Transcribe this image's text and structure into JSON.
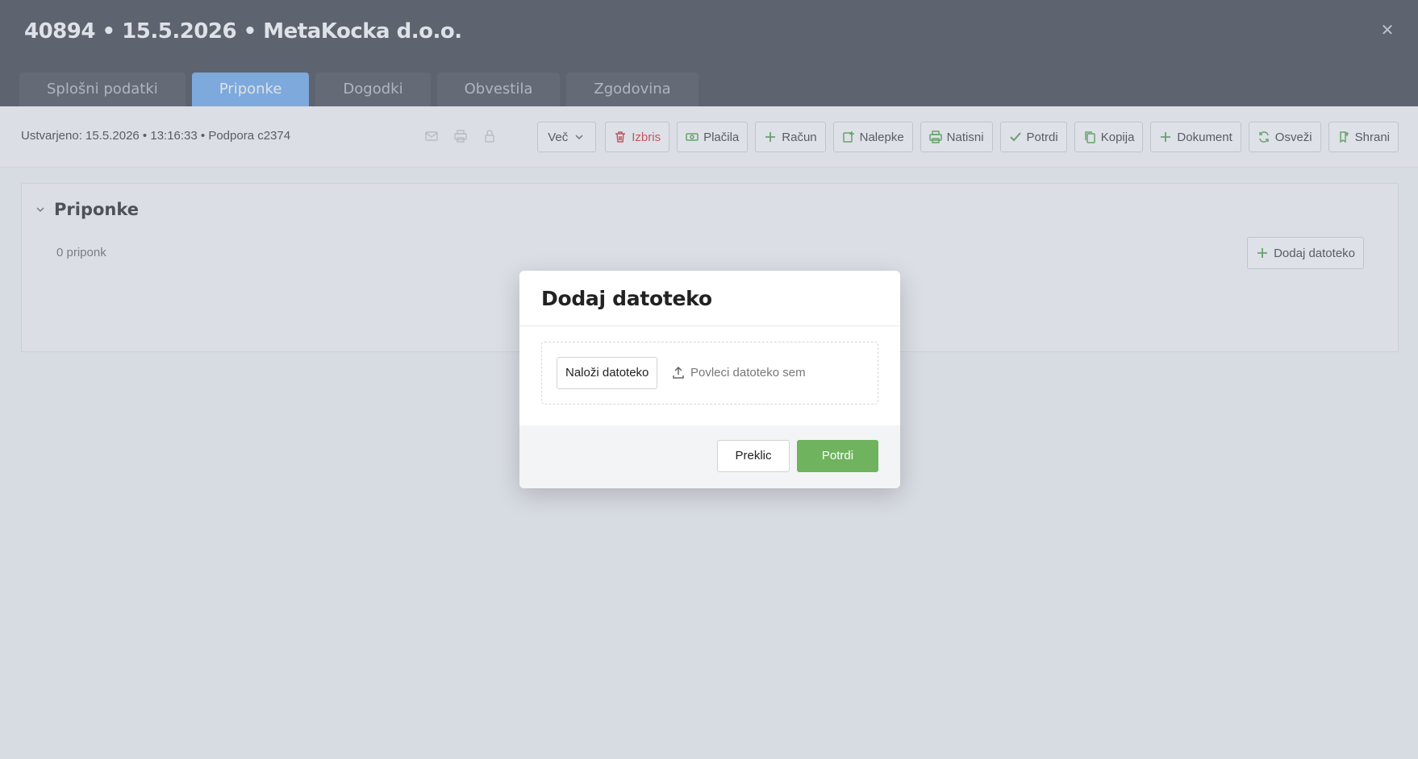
{
  "header": {
    "title": "40894 • 15.5.2026 • MetaKocka d.o.o.",
    "close_icon": "close-icon"
  },
  "tabs": [
    {
      "label": "Splošni podatki",
      "active": false
    },
    {
      "label": "Priponke",
      "active": true
    },
    {
      "label": "Dogodki",
      "active": false
    },
    {
      "label": "Obvestila",
      "active": false
    },
    {
      "label": "Zgodovina",
      "active": false
    }
  ],
  "toolbar": {
    "created_text": "Ustvarjeno: 15.5.2026 • 13:16:33 • Podpora c2374",
    "buttons": [
      {
        "label": "Več",
        "icon": "chevron-down-icon"
      },
      {
        "label": "Izbris",
        "icon": "trash-icon",
        "color": "#cf2b2b"
      },
      {
        "label": "Plačila",
        "icon": "money-icon"
      },
      {
        "label": "Račun",
        "icon": "plus-icon"
      },
      {
        "label": "Nalepke",
        "icon": "label-icon"
      },
      {
        "label": "Natisni",
        "icon": "printer-icon"
      },
      {
        "label": "Potrdi",
        "icon": "check-icon"
      },
      {
        "label": "Kopija",
        "icon": "copy-icon"
      },
      {
        "label": "Dokument",
        "icon": "plus-icon"
      },
      {
        "label": "Osveži",
        "icon": "refresh-icon"
      },
      {
        "label": "Shrani",
        "icon": "bookmark-icon"
      }
    ]
  },
  "panel": {
    "title": "Priponke",
    "count": "0 priponk",
    "add_button": "Dodaj datoteko"
  },
  "modal": {
    "title": "Dodaj datoteko",
    "upload_button": "Naloži datoteko",
    "drag_hint": "Povleci datoteko sem",
    "cancel": "Preklic",
    "confirm": "Potrdi"
  },
  "colors": {
    "header_bg": "#3a3f47",
    "active_tab": "#6aa9ef",
    "accent_green": "#6fb35f",
    "danger": "#cf2b2b"
  }
}
